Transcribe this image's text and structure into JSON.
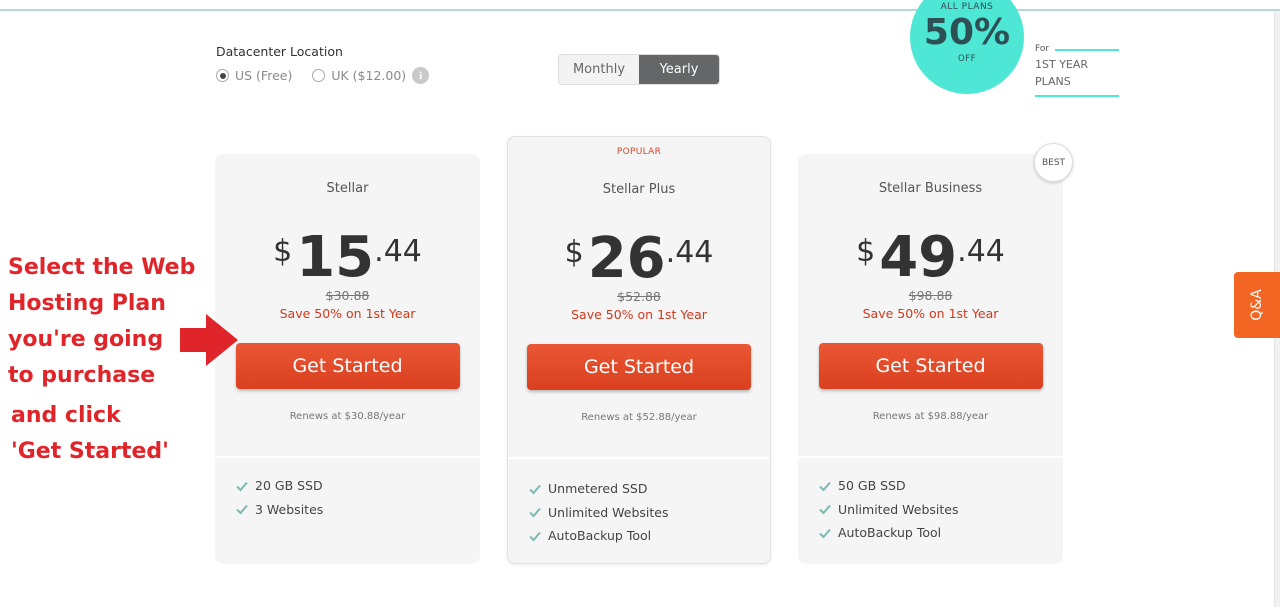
{
  "datacenter": {
    "title": "Datacenter Location",
    "options": [
      {
        "label": "US (Free)",
        "selected": true
      },
      {
        "label": "UK ($12.00)",
        "selected": false
      }
    ],
    "info_icon": "i"
  },
  "billing_toggle": {
    "options": [
      "Monthly",
      "Yearly"
    ],
    "selected": "Yearly"
  },
  "promo_badge": {
    "top": "ALL PLANS",
    "percent": "50%",
    "bottom": "OFF",
    "note_for": "For",
    "note_line1": "1ST YEAR",
    "note_line2": "PLANS",
    "color": "#4ee6d4"
  },
  "plans": [
    {
      "name": "Stellar",
      "currency": "$",
      "price_main": "15",
      "price_cents": ".44",
      "old_price": "$30.88",
      "save": "Save 50% on 1st Year",
      "button": "Get Started",
      "renews": "Renews at $30.88/year",
      "features": [
        "20 GB SSD",
        "3 Websites"
      ]
    },
    {
      "tag": "POPULAR",
      "name": "Stellar Plus",
      "currency": "$",
      "price_main": "26",
      "price_cents": ".44",
      "old_price": "$52.88",
      "save": "Save 50% on 1st Year",
      "button": "Get Started",
      "renews": "Renews at $52.88/year",
      "features": [
        "Unmetered SSD",
        "Unlimited Websites",
        "AutoBackup Tool"
      ]
    },
    {
      "tag": "BEST",
      "name": "Stellar Business",
      "currency": "$",
      "price_main": "49",
      "price_cents": ".44",
      "old_price": "$98.88",
      "save": "Save 50% on 1st Year",
      "button": "Get Started",
      "renews": "Renews at $98.88/year",
      "features": [
        "50 GB SSD",
        "Unlimited Websites",
        "AutoBackup Tool"
      ]
    }
  ],
  "annotation": {
    "lines": [
      "Select the Web",
      "Hosting Plan",
      "you're going",
      "to purchase",
      "and click",
      "'Get Started'"
    ],
    "color": "#e0252a"
  },
  "qa_tab": {
    "label": "Q&A",
    "color": "#f26522"
  },
  "colors": {
    "button": "#e04a27",
    "check": "#7bbab4",
    "accent": "#d0391c"
  }
}
